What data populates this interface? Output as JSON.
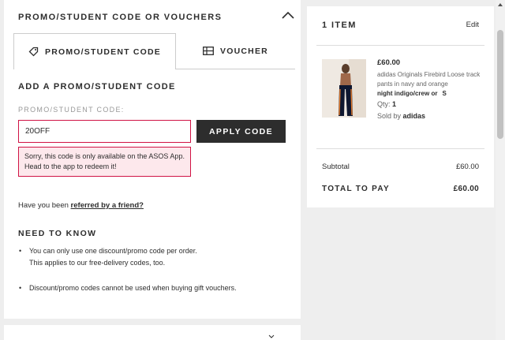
{
  "promo_section": {
    "title": "PROMO/STUDENT CODE OR VOUCHERS",
    "tabs": [
      {
        "label": "PROMO/STUDENT CODE",
        "icon": "tag-icon",
        "active": true
      },
      {
        "label": "VOUCHER",
        "icon": "voucher-icon",
        "active": false
      }
    ],
    "add_title": "ADD A PROMO/STUDENT CODE",
    "field_label": "PROMO/STUDENT CODE:",
    "code_value": "20OFF",
    "apply_label": "APPLY CODE",
    "error_message": "Sorry, this code is only available on the ASOS App. Head to the app to redeem it!",
    "referral_text": "Have you been ",
    "referral_link": "referred by a friend?",
    "need_to_know_title": "NEED TO KNOW",
    "bullets": [
      {
        "line1": "You can only use one discount/promo code per order.",
        "line2": "This applies to our free-delivery codes, too."
      },
      {
        "line1": "Discount/promo codes cannot be used when buying gift vouchers."
      }
    ]
  },
  "bag": {
    "items_count": "1 ITEM",
    "edit_label": "Edit",
    "item": {
      "price": "£60.00",
      "name": "adidas Originals Firebird Loose track pants in navy and orange",
      "colour": "night indigo/crew or",
      "size": "S",
      "qty_label": "Qty:",
      "qty": "1",
      "sold_by_label": "Sold by",
      "sold_by": "adidas"
    },
    "subtotal_label": "Subtotal",
    "subtotal_value": "£60.00",
    "total_label": "TOTAL TO PAY",
    "total_value": "£60.00"
  },
  "colors": {
    "error_border": "#d01345",
    "error_bg": "#fde8ec",
    "button_dark": "#2d2d2d"
  }
}
